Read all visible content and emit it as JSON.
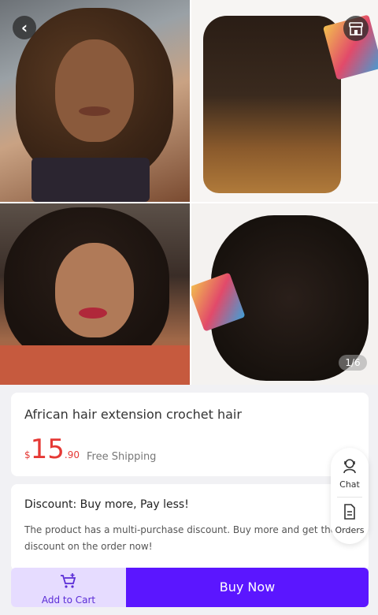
{
  "gallery": {
    "pager": "1/6",
    "images": [
      "model-curly-hair-1",
      "hair-bundle-ombre",
      "model-curly-hair-2",
      "hair-bundle-black"
    ]
  },
  "product": {
    "title": "African hair extension crochet hair",
    "price_currency": "$",
    "price_int": "15",
    "price_dec": ".90",
    "shipping": "Free Shipping"
  },
  "discount": {
    "title": "Discount: Buy more, Pay less!",
    "text": "The product has a multi-purchase discount. Buy more and get the discount on the order now!"
  },
  "side": {
    "chat_label": "Chat",
    "orders_label": "Orders"
  },
  "bottom": {
    "add_to_cart": "Add to Cart",
    "buy_now": "Buy Now"
  },
  "colors": {
    "accent": "#5b16ff",
    "cart_bg": "#e6dcff",
    "price": "#e53935"
  }
}
